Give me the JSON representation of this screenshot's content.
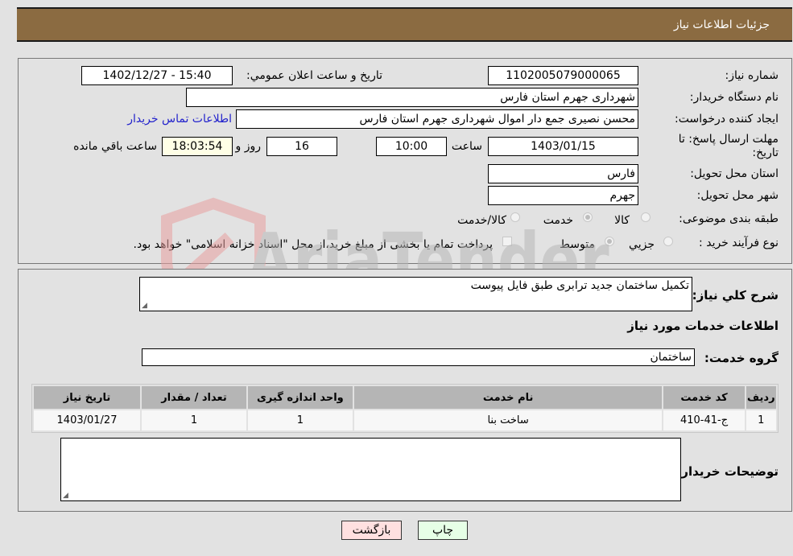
{
  "header": {
    "title": "جزئیات اطلاعات نیاز"
  },
  "details": {
    "need_number_label": "شماره نیاز:",
    "need_number": "1102005079000065",
    "announce_label": "تاریخ و ساعت اعلان عمومي:",
    "announce_value": "1402/12/27 - 15:40",
    "buyer_org_label": "نام دستگاه خریدار:",
    "buyer_org": "شهرداری جهرم استان فارس",
    "creator_label": "ایجاد کننده درخواست:",
    "creator": "محسن نصیری جمع دار اموال  شهرداری جهرم استان فارس",
    "contact_link": "اطلاعات تماس خریدار",
    "deadline_label": "مهلت ارسال پاسخ: تا تاریخ:",
    "deadline_date": "1403/01/15",
    "time_label": "ساعت",
    "deadline_time": "10:00",
    "days_value": "16",
    "days_label": "روز و",
    "remaining_time": "18:03:54",
    "remaining_label": "ساعت باقي مانده",
    "province_label": "استان محل تحویل:",
    "province": "فارس",
    "city_label": "شهر محل تحویل:",
    "city": "جهرم",
    "category_label": "طبقه بندی موضوعی:",
    "category_options": [
      {
        "label": "کالا",
        "selected": false
      },
      {
        "label": "خدمت",
        "selected": true
      },
      {
        "label": "کالا/خدمت",
        "selected": false
      }
    ],
    "process_label": "نوع فرآیند خرید :",
    "process_options": [
      {
        "label": "جزیي",
        "selected": false
      },
      {
        "label": "متوسط",
        "selected": true
      }
    ],
    "treasury_note": "پرداخت تمام یا بخشی از مبلغ خرید،از محل \"اسناد خزانه اسلامی\" خواهد بود.",
    "treasury_checked": false
  },
  "summary": {
    "description_label": "شرح کلي نیاز:",
    "description": "تکمیل ساختمان جدید ترابری طبق فایل پیوست",
    "services_heading": "اطلاعات خدمات مورد نیاز",
    "service_group_label": "گروه خدمت:",
    "service_group": "ساختمان"
  },
  "table": {
    "headers": [
      "ردیف",
      "کد خدمت",
      "نام خدمت",
      "واحد اندازه گیری",
      "تعداد / مقدار",
      "تاریخ نیاز"
    ],
    "rows": [
      [
        "1",
        "ج-41-410",
        "ساخت بنا",
        "1",
        "1",
        "1403/01/27"
      ]
    ]
  },
  "buyer_notes": {
    "label": "توضیحات خریدار:",
    "value": ""
  },
  "buttons": {
    "print": "چاپ",
    "back": "بازگشت"
  },
  "colors": {
    "header_bg": "#8b6b41",
    "print_bg": "#e6ffe6",
    "back_bg": "#ffe0e0",
    "link": "#2222cc"
  },
  "watermark": {
    "text": "AriaTender.neT"
  }
}
